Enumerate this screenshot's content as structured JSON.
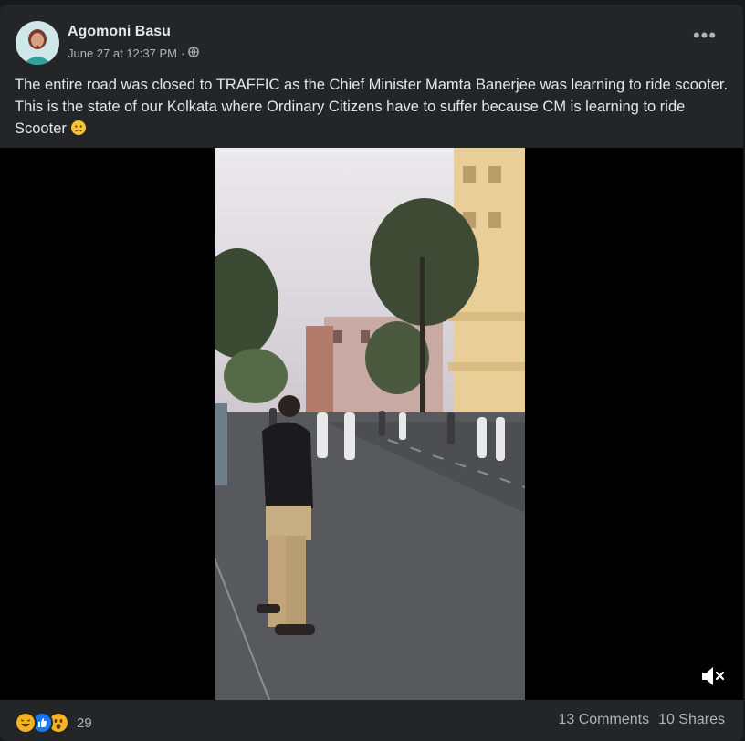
{
  "post": {
    "author": "Agomoni Basu",
    "timestamp": "June 27 at 12:37 PM",
    "separator": "·",
    "privacy_icon": "globe-icon",
    "more_icon": "more-options-icon",
    "text": "The entire road was closed to TRAFFIC as the Chief Minister Mamta Banerjee was learning to ride scooter.  This is the state of our Kolkata where Ordinary Citizens have to suffer because CM is learning to ride Scooter",
    "trailing_emoji": "frowning-face-icon"
  },
  "video": {
    "mute_icon": "muted-speaker-icon"
  },
  "footer": {
    "reactions": [
      "haha-icon",
      "like-icon",
      "wow-icon"
    ],
    "reaction_count": "29",
    "comments": "13 Comments",
    "shares": "10 Shares"
  },
  "colors": {
    "background": "#18191a",
    "card": "#242526",
    "text": "#e4e6eb",
    "secondary_text": "#b0b3b8",
    "like_blue": "#1877f2",
    "reaction_yellow": "#f7b125"
  }
}
